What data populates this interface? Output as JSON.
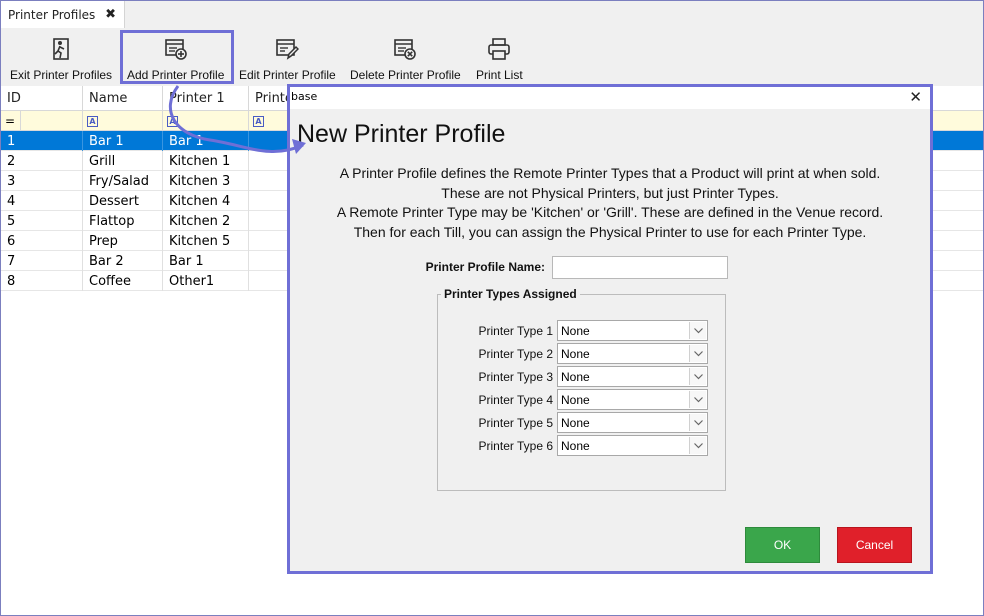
{
  "tab": {
    "title": "Printer Profiles",
    "close": "✖"
  },
  "toolbar": {
    "exit": "Exit Printer Profiles",
    "add": "Add Printer Profile",
    "edit": "Edit Printer Profile",
    "delete": "Delete Printer Profile",
    "print": "Print List"
  },
  "grid": {
    "headers": [
      "ID",
      "Name",
      "Printer 1",
      "Printe"
    ],
    "filter_symbol": "=",
    "filter_icon": "A",
    "rows": [
      {
        "id": "1",
        "name": "Bar 1",
        "printer1": "Bar 1"
      },
      {
        "id": "2",
        "name": "Grill",
        "printer1": "Kitchen 1"
      },
      {
        "id": "3",
        "name": "Fry/Salad",
        "printer1": "Kitchen 3"
      },
      {
        "id": "4",
        "name": "Dessert",
        "printer1": "Kitchen 4"
      },
      {
        "id": "5",
        "name": "Flattop",
        "printer1": "Kitchen 2"
      },
      {
        "id": "6",
        "name": "Prep",
        "printer1": "Kitchen 5"
      },
      {
        "id": "7",
        "name": "Bar 2",
        "printer1": "Bar 1"
      },
      {
        "id": "8",
        "name": "Coffee",
        "printer1": "Other1"
      }
    ]
  },
  "dialog": {
    "window_title": "base",
    "close": "✕",
    "heading": "New Printer Profile",
    "description": [
      "A Printer Profile defines the Remote Printer Types that a Product will print at when sold.",
      "These are not Physical Printers, but just Printer Types.",
      "A Remote Printer Type may be 'Kitchen' or 'Grill'. These are defined in the Venue record.",
      "Then for each Till, you can assign the Physical Printer to use for each Printer Type."
    ],
    "profile_name_label": "Printer Profile Name:",
    "profile_name_value": "",
    "group_title": "Printer Types Assigned",
    "printer_types": [
      {
        "label": "Printer Type 1",
        "value": "None"
      },
      {
        "label": "Printer Type 2",
        "value": "None"
      },
      {
        "label": "Printer Type 3",
        "value": "None"
      },
      {
        "label": "Printer Type 4",
        "value": "None"
      },
      {
        "label": "Printer Type 5",
        "value": "None"
      },
      {
        "label": "Printer Type 6",
        "value": "None"
      }
    ],
    "ok": "OK",
    "cancel": "Cancel"
  },
  "colors": {
    "selection": "#0078d7",
    "highlight": "#6f6fd6",
    "ok": "#3aa64b",
    "cancel": "#e0202a",
    "filter_row": "#fffbdc"
  },
  "icons": {
    "exit": "exit-icon",
    "add": "add-document-icon",
    "edit": "edit-document-icon",
    "delete": "delete-document-icon",
    "print": "printer-icon",
    "dropdown": "chevron-down-icon"
  }
}
